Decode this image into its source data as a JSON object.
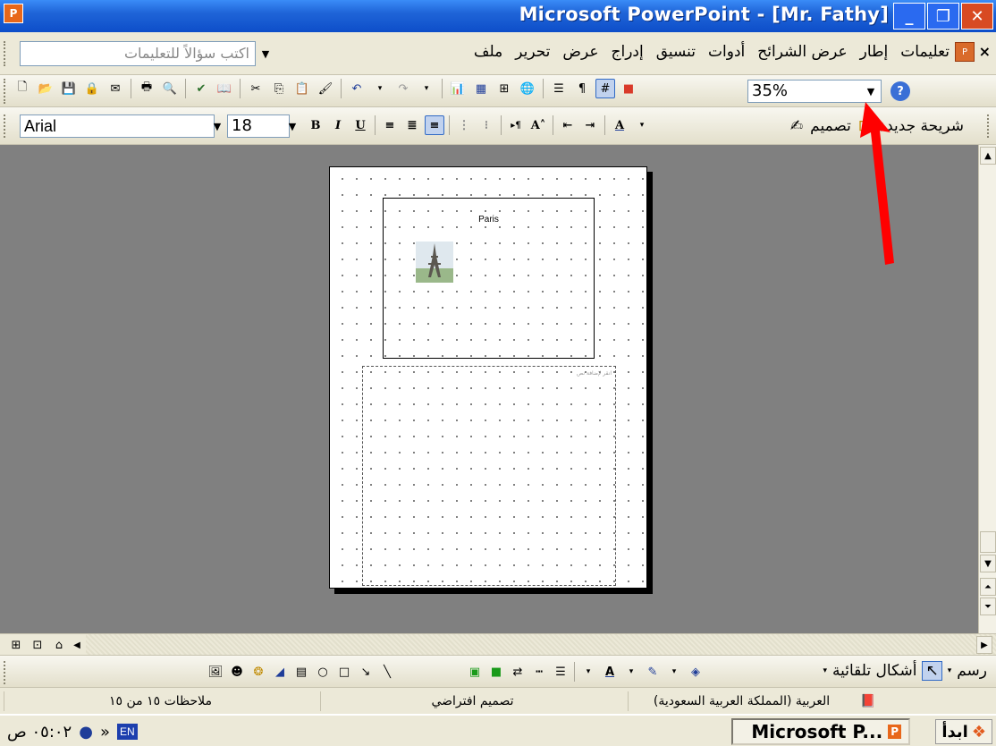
{
  "window": {
    "title": "Microsoft PowerPoint - [Mr. Fathy]",
    "app_icon": "powerpoint-icon",
    "controls": [
      "minimize",
      "restore",
      "close"
    ]
  },
  "menu": {
    "items": [
      "ملف",
      "تحرير",
      "عرض",
      "إدراج",
      "تنسيق",
      "أدوات",
      "عرض الشرائح",
      "إطار",
      "تعليمات"
    ],
    "ask_placeholder": "اكتب سؤالاً للتعليمات",
    "close": "×"
  },
  "standard_toolbar": {
    "zoom_value": "35%"
  },
  "formatting_toolbar": {
    "font": "Arial",
    "size": "18",
    "design_label": "تصميم",
    "new_slide_label": "شريحة جديدة"
  },
  "slide": {
    "caption": "Paris",
    "notes_placeholder": "انقر لإضافة نص"
  },
  "drawing_toolbar": {
    "draw_label": "رسم",
    "autoshapes_label": "أشكال تلقائية"
  },
  "status_bar": {
    "notes_page": "ملاحظات ١٥ من ١٥",
    "design": "تصميم افتراضي",
    "language": "العربية (المملكة العربية السعودية)"
  },
  "taskbar": {
    "start_label": "ابدأ",
    "task_label": "Microsoft P...",
    "lang": "EN",
    "clock": "٠٥:٠٢ ص"
  },
  "colors": {
    "title_bar": "#0d4ec9",
    "workspace": "#808080",
    "arrow": "#ff0000"
  }
}
